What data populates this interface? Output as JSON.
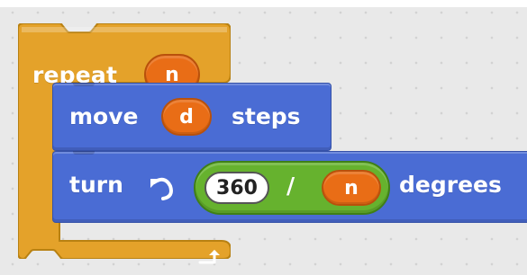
{
  "blocks": {
    "repeat": {
      "label": "repeat",
      "var": "n"
    },
    "move": {
      "label": "move",
      "var": "d",
      "suffix": "steps"
    },
    "turn": {
      "label": "turn",
      "value": "360",
      "operator": "/",
      "var": "n",
      "suffix": "degrees"
    }
  },
  "colors": {
    "control": "#e4a22a",
    "motion": "#4a6cd4",
    "variable": "#e96d16",
    "operator": "#66b22e",
    "canvas": "#e9e9e9"
  },
  "icons": {
    "loop": "loop-arrow-icon",
    "rotate": "rotate-left-icon"
  }
}
